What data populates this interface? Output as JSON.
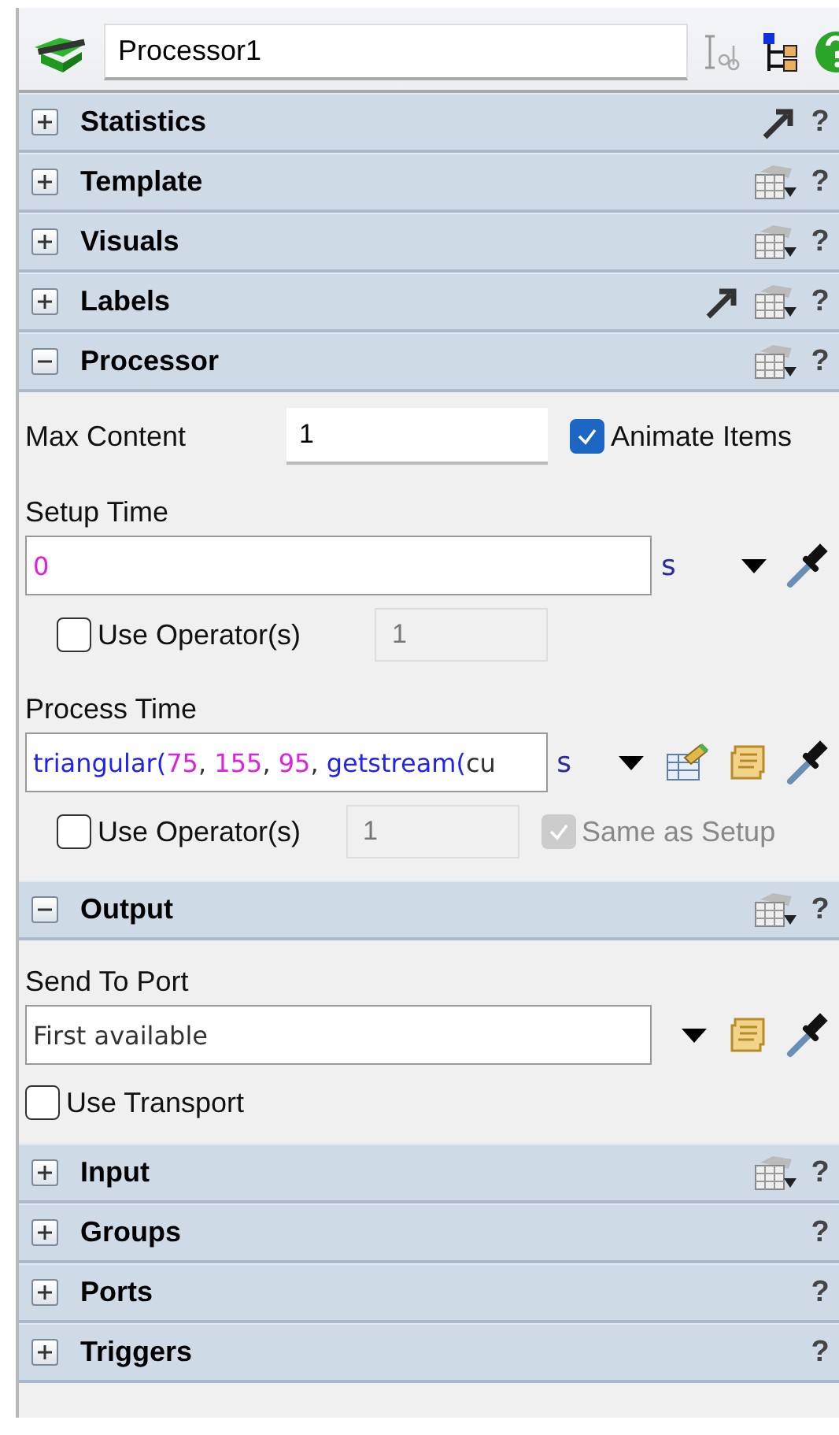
{
  "toolbar": {
    "object_name": "Processor1"
  },
  "sections": [
    {
      "title": "Statistics",
      "expanded": false,
      "tools": [
        {
          "kind": "pointer"
        }
      ],
      "help": "?"
    },
    {
      "title": "Template",
      "expanded": false,
      "tools": [
        {
          "kind": "properties"
        }
      ],
      "help": "?"
    },
    {
      "title": "Visuals",
      "expanded": false,
      "tools": [
        {
          "kind": "properties"
        }
      ],
      "help": "?"
    },
    {
      "title": "Labels",
      "expanded": false,
      "tools": [
        {
          "kind": "pointer"
        },
        {
          "kind": "properties"
        }
      ],
      "help": "?"
    },
    {
      "title": "Processor",
      "expanded": true,
      "tools": [
        {
          "kind": "properties"
        }
      ],
      "help": "?",
      "content": [
        {
          "kind": "inline_field",
          "label": "Max Content",
          "value": "1",
          "checkbox": {
            "label": "Animate Items",
            "checked": true
          }
        },
        {
          "kind": "label",
          "text": "Setup Time"
        },
        {
          "kind": "code_field",
          "tokens": [
            {
              "text": "0",
              "kind": "number"
            }
          ],
          "unit": "s",
          "tools": [
            {
              "kind": "dropdown"
            },
            {
              "kind": "eyedropper"
            }
          ]
        },
        {
          "kind": "operator_row",
          "checkbox": {
            "label": "Use Operator(s)",
            "checked": false
          },
          "value": "1",
          "disabled": true
        },
        {
          "kind": "label",
          "text": "Process Time"
        },
        {
          "kind": "code_field",
          "tokens": [
            {
              "text": "triangular(",
              "kind": "function"
            },
            {
              "text": "75",
              "kind": "number"
            },
            {
              "text": ", ",
              "kind": "plain"
            },
            {
              "text": "155",
              "kind": "number"
            },
            {
              "text": ", ",
              "kind": "plain"
            },
            {
              "text": "95",
              "kind": "number"
            },
            {
              "text": ", ",
              "kind": "plain"
            },
            {
              "text": "getstream(",
              "kind": "function"
            },
            {
              "text": "cu",
              "kind": "plain"
            }
          ],
          "unit": "s",
          "tools": [
            {
              "kind": "dropdown"
            },
            {
              "kind": "table_edit"
            },
            {
              "kind": "script"
            },
            {
              "kind": "eyedropper"
            }
          ]
        },
        {
          "kind": "operator_row",
          "checkbox": {
            "label": "Use Operator(s)",
            "checked": false
          },
          "value": "1",
          "disabled": true,
          "extra_checkbox": {
            "label": "Same as Setup",
            "checked": true,
            "disabled": true
          }
        }
      ]
    },
    {
      "title": "Output",
      "expanded": true,
      "tools": [
        {
          "kind": "properties"
        }
      ],
      "help": "?",
      "content": [
        {
          "kind": "label",
          "text": "Send To Port"
        },
        {
          "kind": "code_field",
          "tokens": [
            {
              "text": "First available",
              "kind": "plain"
            }
          ],
          "tools": [
            {
              "kind": "dropdown"
            },
            {
              "kind": "script"
            },
            {
              "kind": "eyedropper"
            }
          ]
        },
        {
          "kind": "checkbox_row",
          "checkbox": {
            "label": "Use Transport",
            "checked": false
          }
        }
      ]
    },
    {
      "title": "Input",
      "expanded": false,
      "tools": [
        {
          "kind": "properties"
        }
      ],
      "help": "?"
    },
    {
      "title": "Groups",
      "expanded": false,
      "help": "?"
    },
    {
      "title": "Ports",
      "expanded": false,
      "help": "?"
    },
    {
      "title": "Triggers",
      "expanded": false,
      "help": "?"
    }
  ]
}
